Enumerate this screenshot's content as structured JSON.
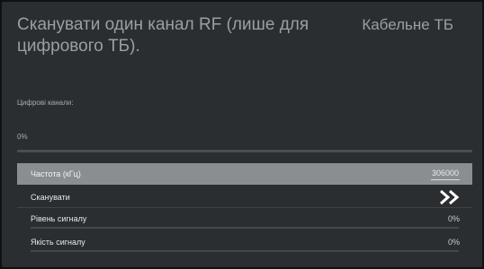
{
  "header": {
    "title": "Сканувати один канал RF (лише для цифрового ТБ).",
    "source": "Кабельне ТБ"
  },
  "digital_channels": {
    "label": "Цифрові канали:",
    "progress_text": "0%",
    "progress": 0
  },
  "rows": {
    "frequency": {
      "label": "Частота (кГц)",
      "value": "306000"
    },
    "scan": {
      "label": "Сканувати",
      "icon": "double-chevron-right-icon"
    },
    "signal_level": {
      "label": "Рівень сигналу",
      "value": "0%",
      "level": 0
    },
    "signal_quality": {
      "label": "Якість сигналу",
      "value": "0%",
      "level": 0
    }
  },
  "colors": {
    "panel": "#2b2e30",
    "selected_row": "#8a8e91",
    "text": "#e6e8e9"
  }
}
